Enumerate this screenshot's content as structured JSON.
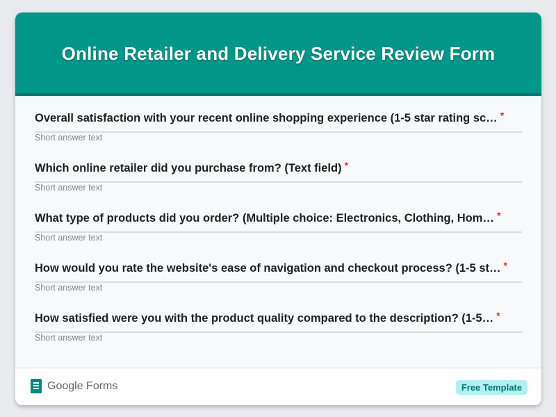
{
  "form": {
    "title": "Online Retailer and Delivery Service Review Form"
  },
  "colors": {
    "header": "#009688",
    "header_border": "#00796b",
    "required": "#d93025",
    "badge_bg": "#b2f1f3"
  },
  "questions": [
    {
      "text": "Overall satisfaction with your recent online shopping experience (1-5 star rating sc…",
      "required_mark": "*",
      "placeholder": "Short answer text"
    },
    {
      "text": "Which online retailer did you purchase from? (Text field)",
      "required_mark": "*",
      "placeholder": "Short answer text"
    },
    {
      "text": "What type of products did you order? (Multiple choice: Electronics, Clothing, Hom…",
      "required_mark": "*",
      "placeholder": "Short answer text"
    },
    {
      "text": "How would you rate the website's ease of navigation and checkout process? (1-5 st…",
      "required_mark": "*",
      "placeholder": "Short answer text"
    },
    {
      "text": "How satisfied were you with the product quality compared to the description? (1-5…",
      "required_mark": "*",
      "placeholder": "Short answer text"
    }
  ],
  "footer": {
    "brand_icon": "google-forms-icon",
    "brand_name": "Google Forms",
    "badge": "Free Template"
  }
}
